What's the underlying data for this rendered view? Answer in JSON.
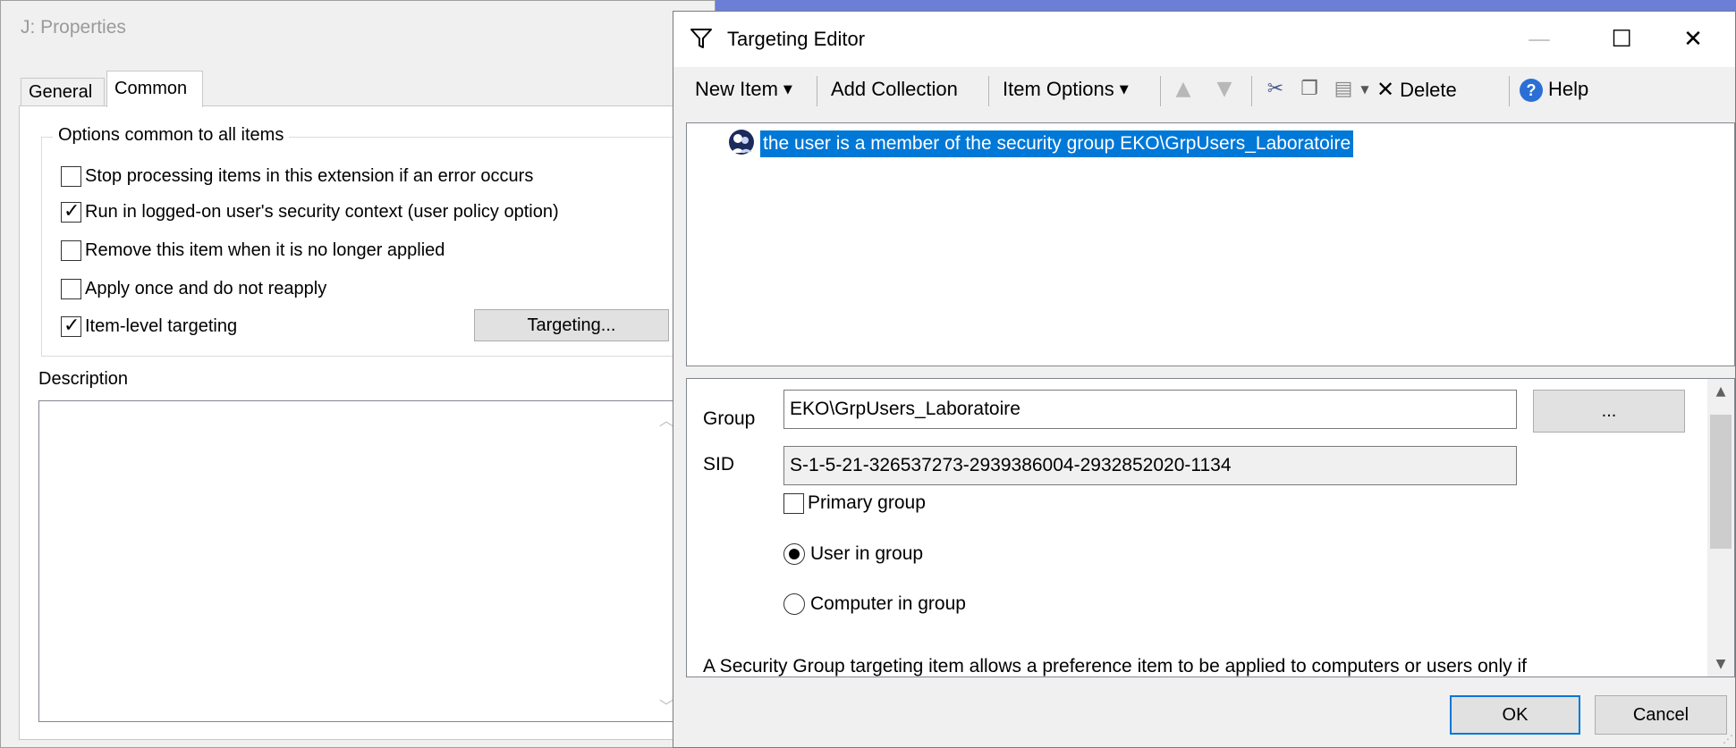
{
  "properties_window": {
    "title": "J: Properties",
    "tabs": [
      {
        "label": "General",
        "active": false
      },
      {
        "label": "Common",
        "active": true
      }
    ],
    "options_group": {
      "legend": "Options common to all items",
      "options": [
        {
          "label": "Stop processing items in this extension if an error occurs",
          "checked": false
        },
        {
          "label": "Run in logged-on user's security context (user policy option)",
          "checked": true
        },
        {
          "label": "Remove this item when it is no longer applied",
          "checked": false
        },
        {
          "label": "Apply once and do not reapply",
          "checked": false
        },
        {
          "label": "Item-level targeting",
          "checked": true
        }
      ],
      "targeting_button": "Targeting..."
    },
    "description_label": "Description",
    "description_value": ""
  },
  "targeting_editor": {
    "title": "Targeting Editor",
    "window_buttons": {
      "minimize": "—",
      "maximize": "☐",
      "close": "✕"
    },
    "toolbar": {
      "new_item": "New Item",
      "add_collection": "Add Collection",
      "item_options": "Item Options",
      "delete": "Delete",
      "help": "Help",
      "icons": {
        "move_up": "arrow-up-icon",
        "move_down": "arrow-down-icon",
        "cut": "scissors-icon",
        "copy": "copy-icon",
        "paste": "paste-icon",
        "delete": "x-icon",
        "help": "help-icon"
      }
    },
    "tree": {
      "items": [
        {
          "label": "the user is a member of the security group EKO\\GrpUsers_Laboratoire",
          "selected": true,
          "icon": "security-group-icon"
        }
      ]
    },
    "properties": {
      "group_label": "Group",
      "group_value": "EKO\\GrpUsers_Laboratoire",
      "browse_button": "...",
      "sid_label": "SID",
      "sid_value": "S-1-5-21-326537273-2939386004-2932852020-1134",
      "primary_group": {
        "label": "Primary group",
        "checked": false
      },
      "radios": [
        {
          "label": "User in group",
          "selected": true
        },
        {
          "label": "Computer in group",
          "selected": false
        }
      ],
      "help_text": "A Security Group targeting item allows a preference item to be applied to computers or users only if"
    },
    "buttons": {
      "ok": "OK",
      "cancel": "Cancel"
    },
    "colors": {
      "selection": "#0078d7",
      "ok_border": "#0078d7"
    }
  }
}
